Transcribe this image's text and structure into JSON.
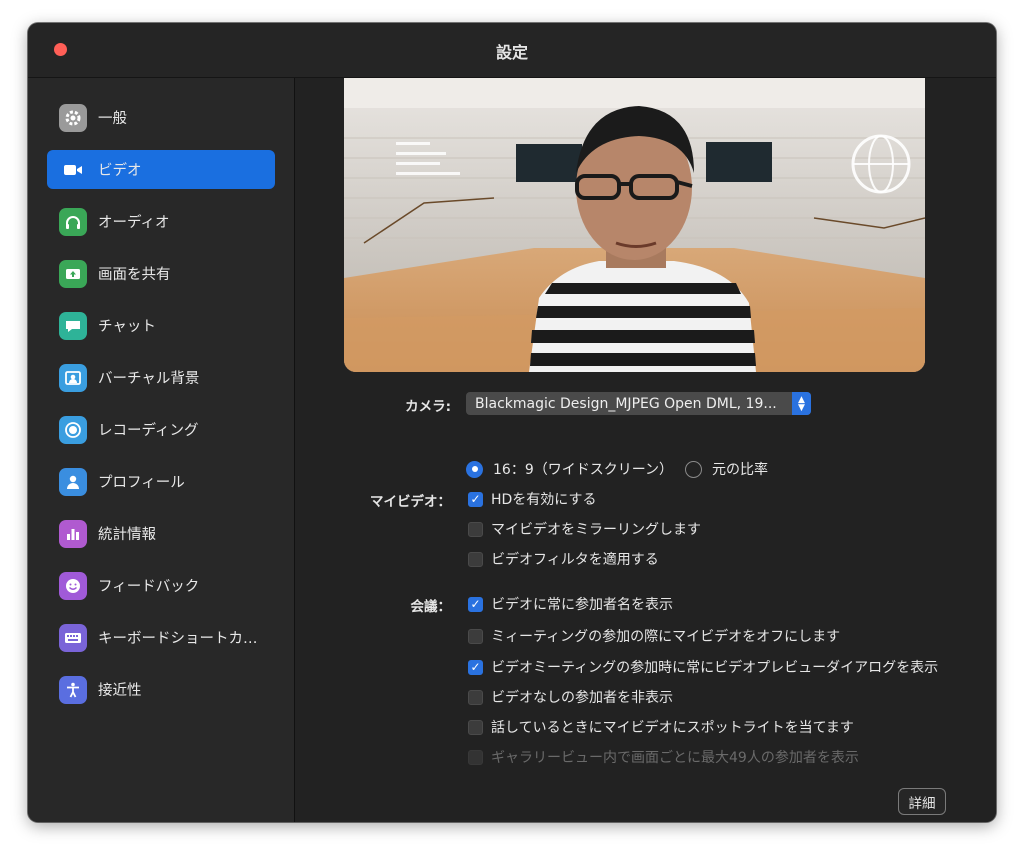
{
  "window": {
    "title": "設定"
  },
  "sidebar": {
    "items": [
      {
        "label": "一般",
        "icon": "gear-icon",
        "color": "#9a9a9a",
        "active": false
      },
      {
        "label": "ビデオ",
        "icon": "video-camera-icon",
        "color": "#1a6fe0",
        "active": true
      },
      {
        "label": "オーディオ",
        "icon": "headphones-icon",
        "color": "#3aa757",
        "active": false
      },
      {
        "label": "画面を共有",
        "icon": "share-screen-icon",
        "color": "#3aa757",
        "active": false
      },
      {
        "label": "チャット",
        "icon": "chat-bubble-icon",
        "color": "#2eb398",
        "active": false
      },
      {
        "label": "バーチャル背景",
        "icon": "virtual-background-icon",
        "color": "#3a9ee0",
        "active": false
      },
      {
        "label": "レコーディング",
        "icon": "record-icon",
        "color": "#3a9ee0",
        "active": false
      },
      {
        "label": "プロフィール",
        "icon": "user-profile-icon",
        "color": "#3a8ee0",
        "active": false
      },
      {
        "label": "統計情報",
        "icon": "statistics-icon",
        "color": "#b05ad0",
        "active": false
      },
      {
        "label": "フィードバック",
        "icon": "smile-icon",
        "color": "#a05ad8",
        "active": false
      },
      {
        "label": "キーボードショートカ…",
        "icon": "keyboard-icon",
        "color": "#7a64d8",
        "active": false
      },
      {
        "label": "接近性",
        "icon": "accessibility-icon",
        "color": "#5a6ee0",
        "active": false
      }
    ]
  },
  "video": {
    "camera_label": "カメラ:",
    "camera_value": "Blackmagic Design_MJPEG Open DML, 19...",
    "my_video_label": "マイビデオ：",
    "aspect_options": [
      {
        "label": "16：9（ワイドスクリーン）",
        "selected": true
      },
      {
        "label": "元の比率",
        "selected": false
      }
    ],
    "my_video_options": [
      {
        "label": "HDを有効にする",
        "checked": true
      },
      {
        "label": "マイビデオをミラーリングします",
        "checked": false
      },
      {
        "label": "ビデオフィルタを適用する",
        "checked": false
      }
    ],
    "meeting_label": "会議：",
    "meeting_options": [
      {
        "label": "ビデオに常に参加者名を表示",
        "checked": true,
        "disabled": false
      },
      {
        "label": "ミィーティングの参加の際にマイビデオをオフにします",
        "checked": false,
        "disabled": false
      },
      {
        "label": "ビデオミーティングの参加時に常にビデオプレビューダイアログを表示",
        "checked": true,
        "disabled": false
      },
      {
        "label": "ビデオなしの参加者を非表示",
        "checked": false,
        "disabled": false
      },
      {
        "label": "話しているときにマイビデオにスポットライトを当てます",
        "checked": false,
        "disabled": false
      },
      {
        "label": "ギャラリービュー内で画面ごとに最大49人の参加者を表示",
        "checked": false,
        "disabled": true
      }
    ],
    "detail_button": "詳細"
  }
}
